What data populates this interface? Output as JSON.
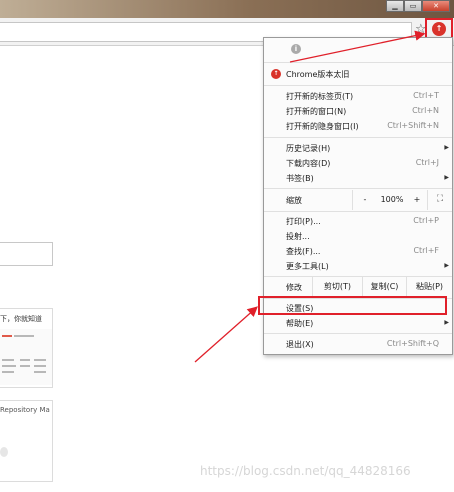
{
  "window": {
    "buttons": {
      "minimize": "▁",
      "restore": "▭",
      "close": "✕"
    }
  },
  "toolbar": {
    "star_icon": "☆",
    "update_icon": "↑"
  },
  "page": {
    "card1_text": "下，你就知道",
    "card2_text": "Repository Ma"
  },
  "menu": {
    "info_icon": "i",
    "update_item": {
      "icon": "↑",
      "label": "Chrome版本太旧"
    },
    "group1": [
      {
        "label": "打开新的标签页(T)",
        "shortcut": "Ctrl+T"
      },
      {
        "label": "打开新的窗口(N)",
        "shortcut": "Ctrl+N"
      },
      {
        "label": "打开新的隐身窗口(I)",
        "shortcut": "Ctrl+Shift+N"
      }
    ],
    "group2": [
      {
        "label": "历史记录(H)",
        "shortcut": "",
        "arrow": "▶"
      },
      {
        "label": "下载内容(D)",
        "shortcut": "Ctrl+J"
      },
      {
        "label": "书签(B)",
        "shortcut": "",
        "arrow": "▶"
      }
    ],
    "zoom": {
      "label": "缩放",
      "minus": "-",
      "value": "100%",
      "plus": "+",
      "fullscreen_icon": "⛶"
    },
    "group3": [
      {
        "label": "打印(P)...",
        "shortcut": "Ctrl+P"
      },
      {
        "label": "投射...",
        "shortcut": ""
      },
      {
        "label": "查找(F)...",
        "shortcut": "Ctrl+F"
      },
      {
        "label": "更多工具(L)",
        "shortcut": "",
        "arrow": "▶"
      }
    ],
    "edit": {
      "label": "修改",
      "cut": "剪切(T)",
      "copy": "复制(C)",
      "paste": "粘贴(P)"
    },
    "settings": {
      "label": "设置(S)"
    },
    "help": {
      "label": "帮助(E)",
      "arrow": "▶"
    },
    "exit": {
      "label": "退出(X)",
      "shortcut": "Ctrl+Shift+Q"
    }
  },
  "watermark": "https://blog.csdn.net/qq_44828166",
  "colors": {
    "highlight": "#e0202a",
    "update_red": "#d9322a"
  }
}
